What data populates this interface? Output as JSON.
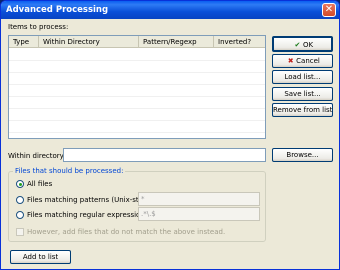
{
  "window": {
    "title": "Advanced Processing",
    "close_glyph": "✕"
  },
  "items_label": "Items to process:",
  "table": {
    "columns": [
      "Type",
      "Within Directory",
      "Pattern/Regexp",
      "Inverted?"
    ],
    "rows": []
  },
  "buttons": {
    "ok": "OK",
    "ok_icon": "✔",
    "cancel": "Cancel",
    "cancel_icon": "✖",
    "load_list": "Load list...",
    "save_list": "Save list...",
    "remove_from_list": "Remove from list",
    "browse": "Browse...",
    "add_to_list": "Add to list"
  },
  "within_directory": {
    "label": "Within directory:",
    "value": ""
  },
  "files_group": {
    "legend": "Files that should be processed:",
    "options": [
      {
        "label": "All files",
        "selected": true
      },
      {
        "label": "Files matching patterns (Unix-style):",
        "selected": false,
        "value": "*"
      },
      {
        "label": "Files matching regular expression:",
        "selected": false,
        "value": ".*\\.$"
      }
    ],
    "also_add_label": "However, add files that do not match the above instead."
  }
}
